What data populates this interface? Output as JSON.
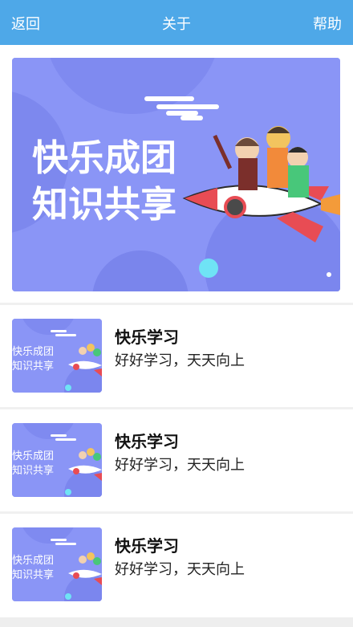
{
  "header": {
    "back_label": "返回",
    "title": "关于",
    "help_label": "帮助",
    "background": "#4ea8e8"
  },
  "banner": {
    "line1": "快乐成团",
    "line2": "知识共享",
    "background": "#8a95f6"
  },
  "list": [
    {
      "title": "快乐学习",
      "subtitle": "好好学习，天天向上",
      "thumb_line1": "快乐成团",
      "thumb_line2": "知识共享"
    },
    {
      "title": "快乐学习",
      "subtitle": "好好学习，天天向上",
      "thumb_line1": "快乐成团",
      "thumb_line2": "知识共享"
    },
    {
      "title": "快乐学习",
      "subtitle": "好好学习，天天向上",
      "thumb_line1": "快乐成团",
      "thumb_line2": "知识共享"
    }
  ]
}
